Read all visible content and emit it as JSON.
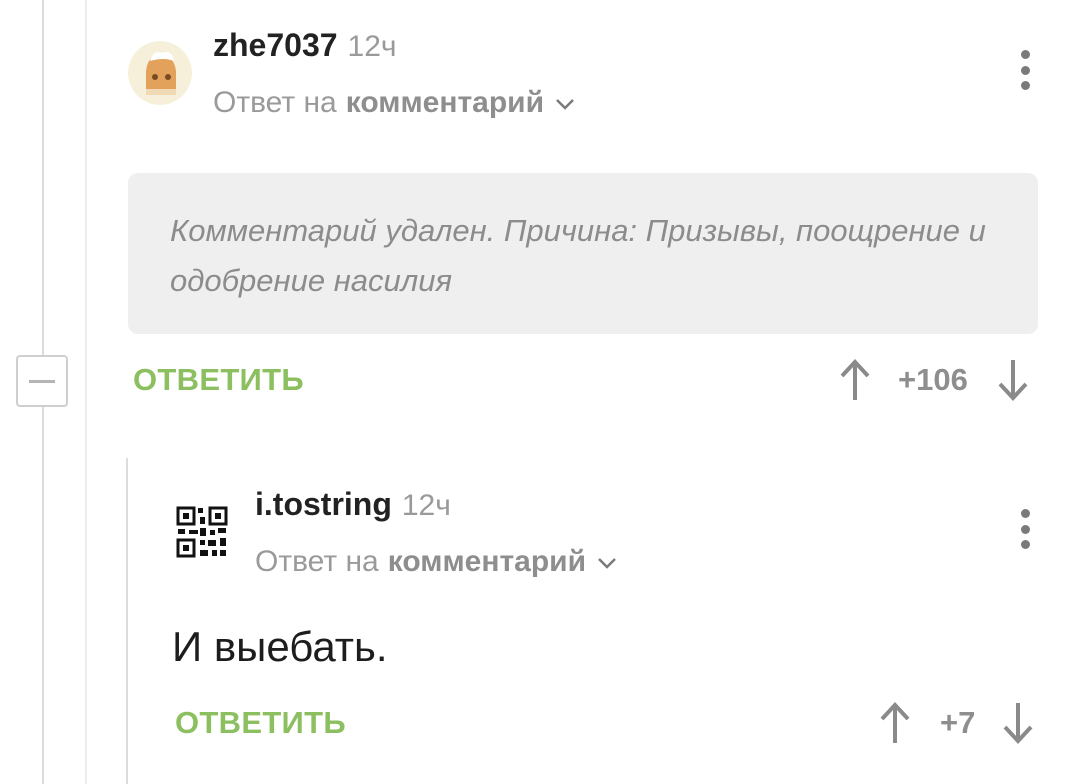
{
  "comments": [
    {
      "username": "zhe7037",
      "time": "12ч",
      "reply_prefix": "Ответ на",
      "reply_target": "комментарий",
      "deleted_text": "Комментарий удален. Причина: Призывы, поощрение и одобрение насилия",
      "reply_label": "ОТВЕТИТЬ",
      "score": "+106"
    },
    {
      "username": "i.tostring",
      "time": "12ч",
      "reply_prefix": "Ответ на",
      "reply_target": "комментарий",
      "text": "И выебать.",
      "reply_label": "ОТВЕТИТЬ",
      "score": "+7"
    }
  ],
  "icons": [
    "more-vertical-icon",
    "chevron-down-icon",
    "arrow-up-icon",
    "arrow-down-icon",
    "collapse-minus-icon"
  ],
  "colors": {
    "accent_green": "#8cbf5f",
    "muted_text": "#9a9a9a",
    "deleted_bg": "#efefef"
  }
}
